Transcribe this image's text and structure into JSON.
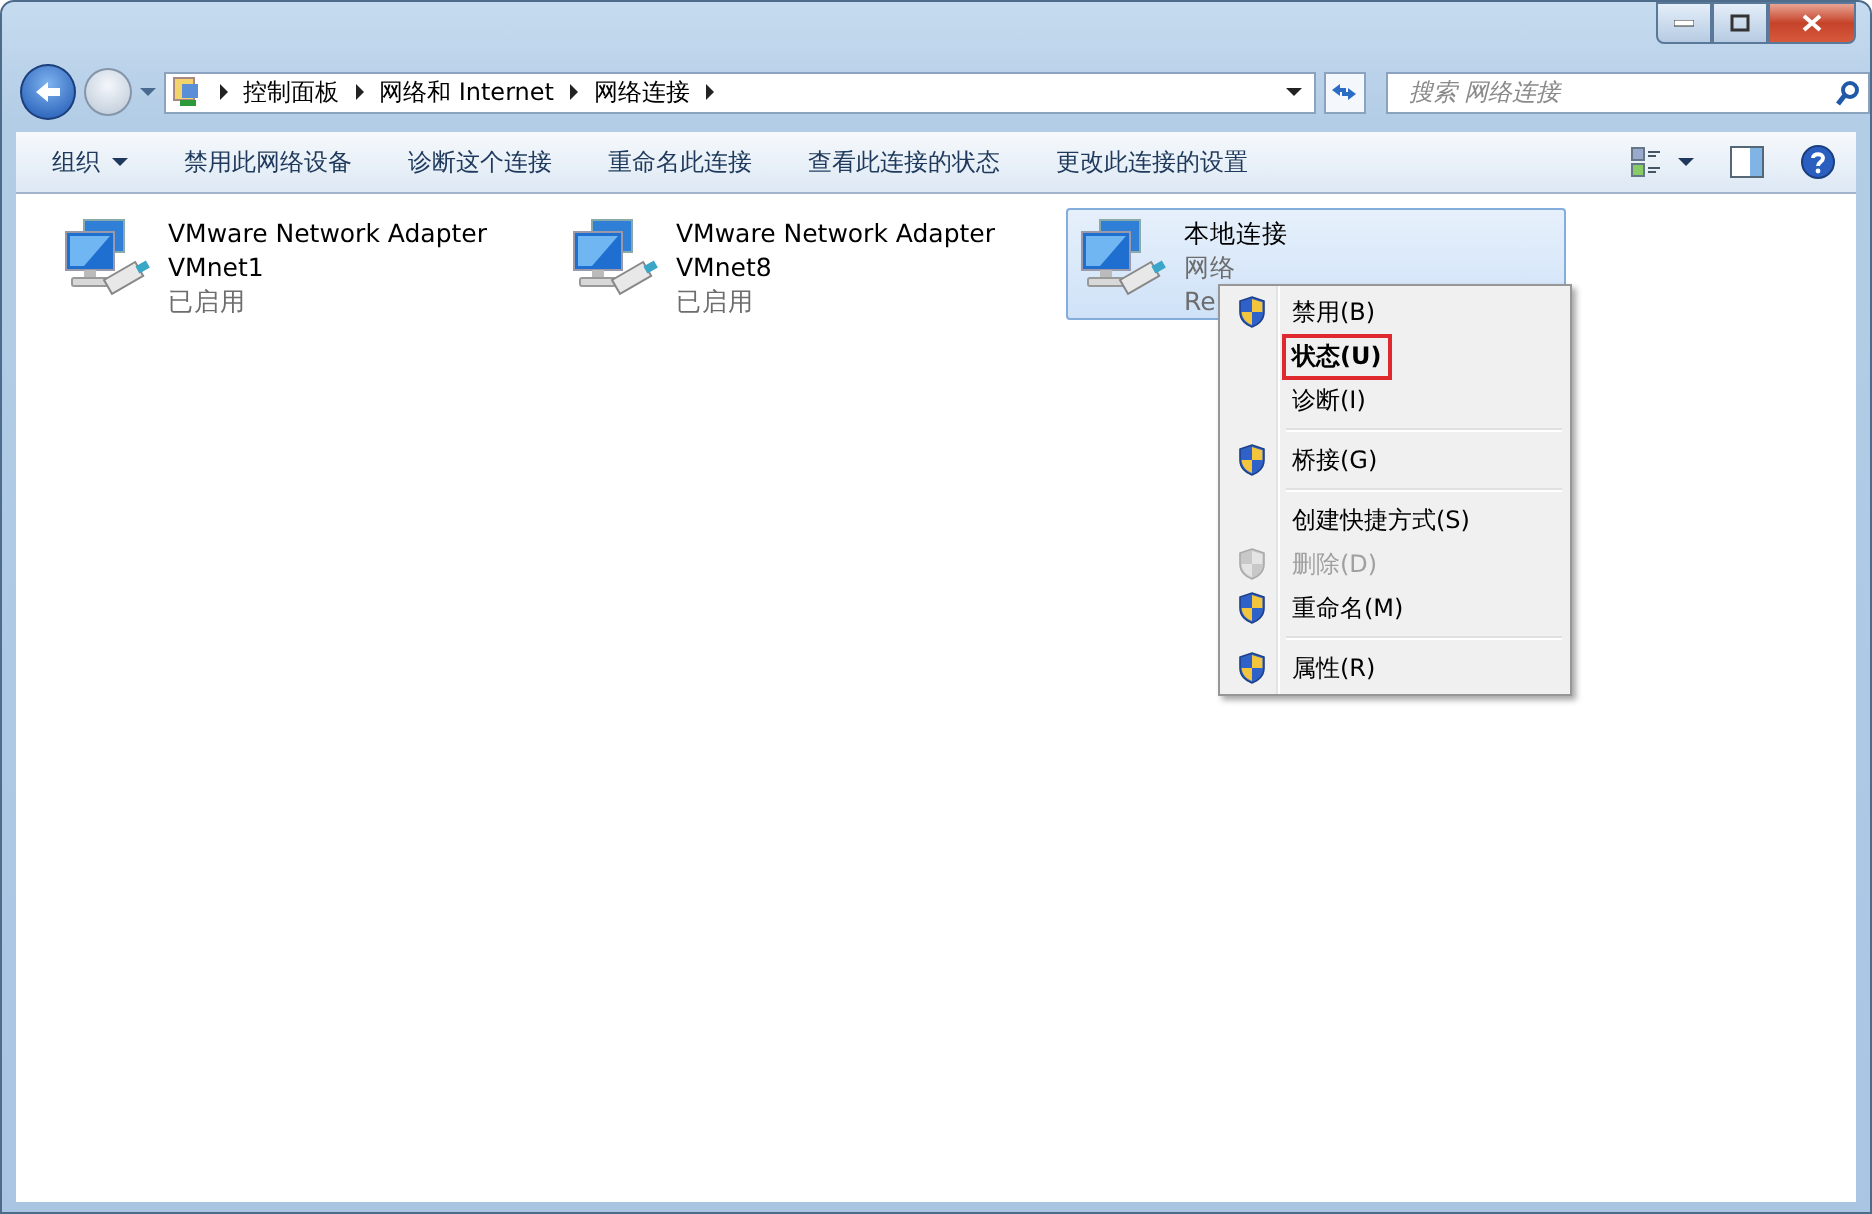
{
  "address_bar": {
    "crumbs": [
      "控制面板",
      "网络和 Internet",
      "网络连接"
    ]
  },
  "search": {
    "placeholder": "搜索 网络连接"
  },
  "toolbar": {
    "items": [
      {
        "label": "组织",
        "dropdown": true
      },
      {
        "label": "禁用此网络设备",
        "dropdown": false
      },
      {
        "label": "诊断这个连接",
        "dropdown": false
      },
      {
        "label": "重命名此连接",
        "dropdown": false
      },
      {
        "label": "查看此连接的状态",
        "dropdown": false
      },
      {
        "label": "更改此连接的设置",
        "dropdown": false
      }
    ]
  },
  "connections": [
    {
      "name": "VMware Network Adapter VMnet1",
      "status": "已启用",
      "selected": false
    },
    {
      "name": "VMware Network Adapter VMnet8",
      "status": "已启用",
      "selected": false
    },
    {
      "name": "本地连接",
      "status": "网络",
      "device": "Re",
      "selected": true
    }
  ],
  "context_menu": {
    "items": [
      {
        "kind": "item",
        "label": "禁用(B)",
        "shield": true,
        "default": false,
        "disabled": false,
        "highlighted": false
      },
      {
        "kind": "item",
        "label": "状态(U)",
        "shield": false,
        "default": true,
        "disabled": false,
        "highlighted": true
      },
      {
        "kind": "item",
        "label": "诊断(I)",
        "shield": false,
        "default": false,
        "disabled": false,
        "highlighted": false
      },
      {
        "kind": "separator"
      },
      {
        "kind": "item",
        "label": "桥接(G)",
        "shield": true,
        "default": false,
        "disabled": false,
        "highlighted": false
      },
      {
        "kind": "separator"
      },
      {
        "kind": "item",
        "label": "创建快捷方式(S)",
        "shield": false,
        "default": false,
        "disabled": false,
        "highlighted": false
      },
      {
        "kind": "item",
        "label": "删除(D)",
        "shield": true,
        "default": false,
        "disabled": true,
        "highlighted": false
      },
      {
        "kind": "item",
        "label": "重命名(M)",
        "shield": true,
        "default": false,
        "disabled": false,
        "highlighted": false
      },
      {
        "kind": "separator"
      },
      {
        "kind": "item",
        "label": "属性(R)",
        "shield": true,
        "default": false,
        "disabled": false,
        "highlighted": false
      }
    ]
  }
}
